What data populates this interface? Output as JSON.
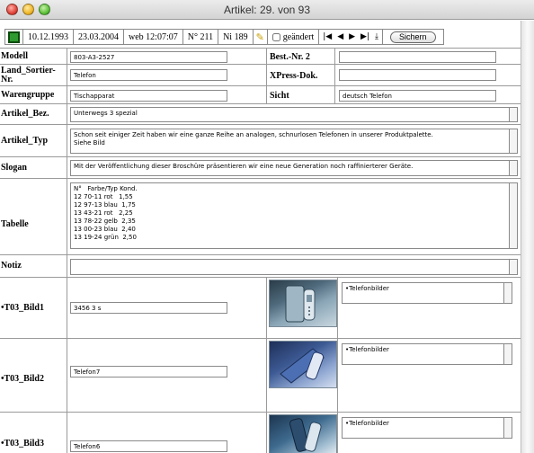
{
  "window": {
    "title": "Artikel: 29. von 93"
  },
  "toolbar": {
    "date_created": "10.12.1993",
    "date_modified": "23.03.2004",
    "user_time": "web 12:07:07",
    "number": "N° 211",
    "ni": "Ni 189",
    "changed_label": "geändert",
    "save_label": "Sichern",
    "nav": [
      "|◀",
      "◀",
      "▶",
      "▶|",
      "⤓"
    ]
  },
  "fields": {
    "modell_label": "Modell",
    "modell_value": "803-A3-2527",
    "best_nr_label": "Best.-Nr. 2",
    "best_nr_value": "",
    "land_label": "Land_Sortier-Nr.",
    "land_value": "Telefon",
    "xpress_label": "XPress-Dok.",
    "xpress_value": "",
    "waren_label": "Warengruppe",
    "waren_value": "Tischapparat",
    "sicht_label": "Sicht",
    "sicht_value": "deutsch Telefon",
    "bez_label": "Artikel_Bez.",
    "bez_value": "Unterwegs 3 spezial",
    "typ_label": "Artikel_Typ",
    "typ_value": "Schon seit einiger Zeit haben wir eine ganze Reihe an analogen, schnurlosen Telefonen in unserer Produktpalette.\nSiehe Bild",
    "slogan_label": "Slogan",
    "slogan_value": "Mit der Veröffentlichung dieser Broschüre präsentieren wir eine neue Generation noch raffinierterer Geräte.",
    "tabelle_label": "Tabelle",
    "tabelle_value": "N°   Farbe/Typ Kond.\n12 70-11 rot   1,55\n12 97-13 blau  1,75\n13 43-21 rot   2,25\n13 78-22 gelb  2,35\n13 00-23 blau  2,40\n13 19-24 grün  2,50",
    "notiz_label": "Notiz",
    "notiz_value": ""
  },
  "images": [
    {
      "label": "•T03_Bild1",
      "value": "3456 3 s",
      "category": "•Telefonbilder"
    },
    {
      "label": "•T03_Bild2",
      "value": "Telefon7",
      "category": "•Telefonbilder"
    },
    {
      "label": "•T03_Bild3",
      "value": "Telefon6",
      "category": "•Telefonbilder"
    }
  ],
  "colors": {
    "accent_green": "#2f9a2f",
    "pen_yellow": "#c8a000",
    "border_gray": "#9a9a9a"
  }
}
